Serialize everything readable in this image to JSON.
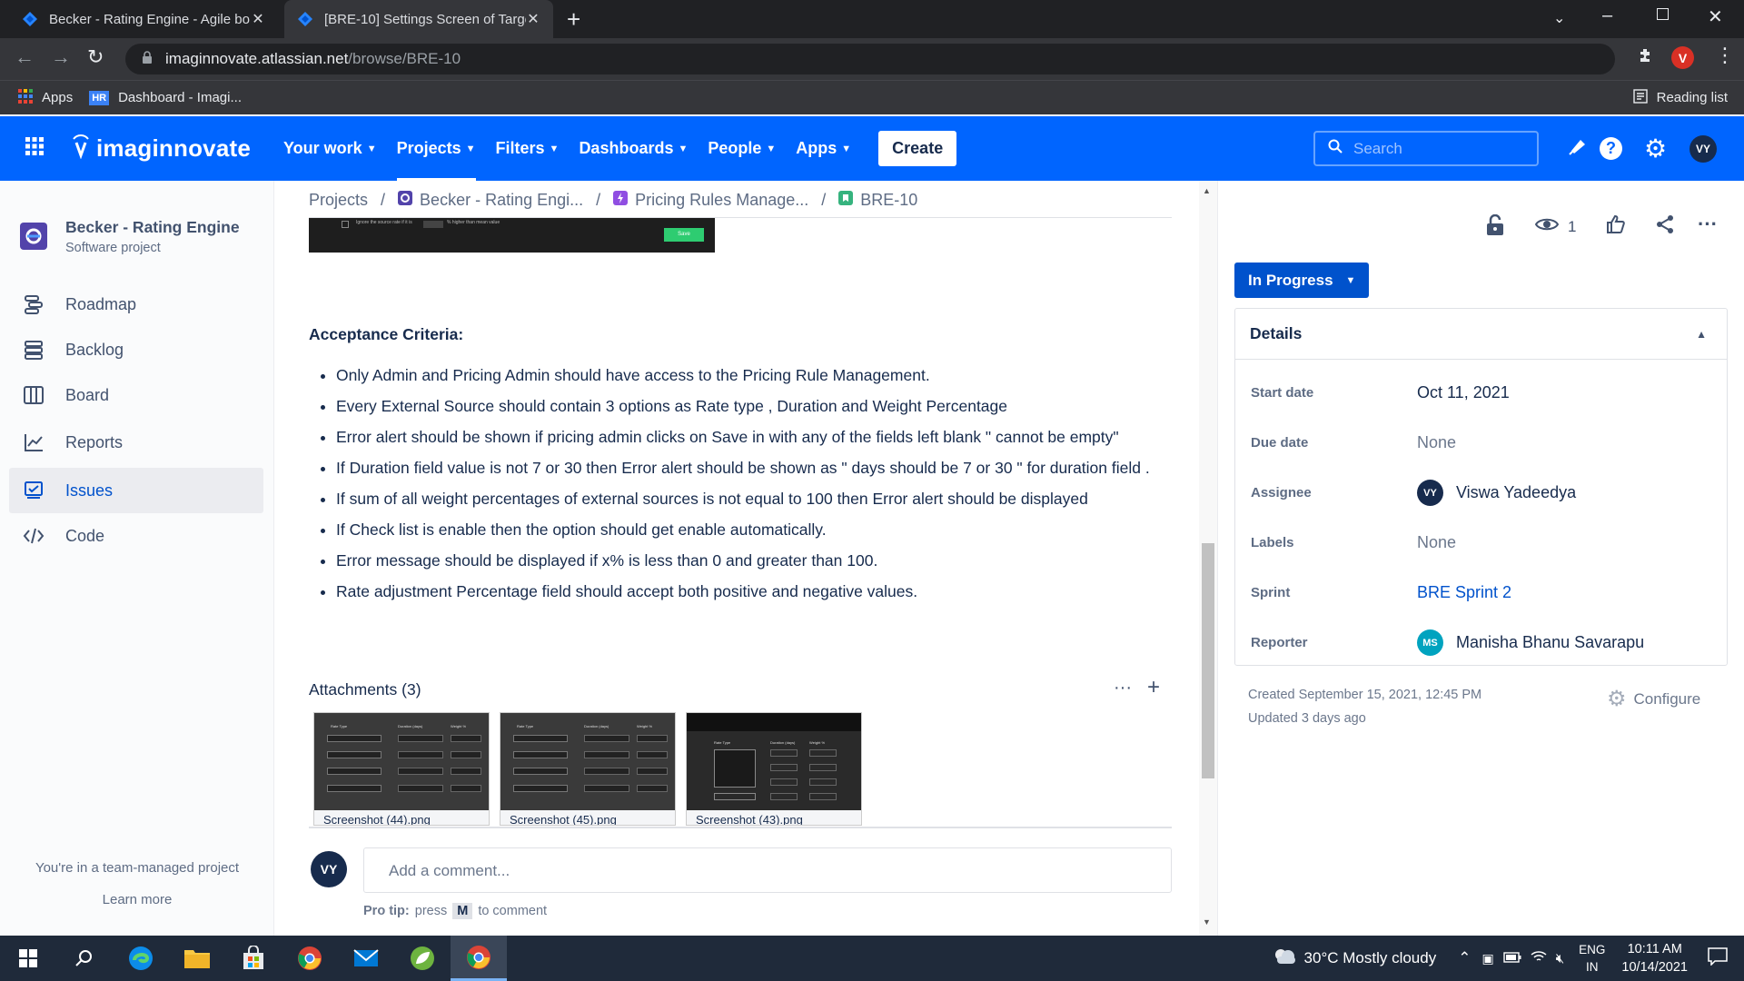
{
  "browser": {
    "tabs": [
      {
        "title": "Becker - Rating Engine - Agile bo"
      },
      {
        "title": "[BRE-10] Settings Screen of Targe"
      }
    ],
    "url_host": "imaginnovate.atlassian.net",
    "url_path": "/browse/BRE-10",
    "profile_initial": "V",
    "bookmarks": [
      {
        "label": "Apps"
      },
      {
        "label": "Dashboard - Imagi..."
      }
    ],
    "bookmark_badge": "HR",
    "reading_list": "Reading list"
  },
  "topnav": {
    "brand": "imaginnovate",
    "items": [
      {
        "label": "Your work"
      },
      {
        "label": "Projects"
      },
      {
        "label": "Filters"
      },
      {
        "label": "Dashboards"
      },
      {
        "label": "People"
      },
      {
        "label": "Apps"
      }
    ],
    "create_label": "Create",
    "search_placeholder": "Search",
    "user_initials": "VY",
    "accent": "#0065ff"
  },
  "sidebar": {
    "project_name": "Becker - Rating Engine",
    "project_type": "Software project",
    "items": [
      {
        "label": "Roadmap",
        "icon": "roadmap-icon"
      },
      {
        "label": "Backlog",
        "icon": "backlog-icon"
      },
      {
        "label": "Board",
        "icon": "board-icon"
      },
      {
        "label": "Reports",
        "icon": "reports-icon"
      },
      {
        "label": "Issues",
        "icon": "issues-icon"
      },
      {
        "label": "Code",
        "icon": "code-icon"
      }
    ],
    "active": "Issues",
    "footer_text": "You're in a team-managed project",
    "learn_more": "Learn more"
  },
  "breadcrumb": {
    "items": [
      "Projects",
      "Becker - Rating Engi...",
      "Pricing Rules Manage...",
      "BRE-10"
    ],
    "sep": "/"
  },
  "issue": {
    "mini_save": "Save",
    "mini_text_1": "Ignore the source rate if it is",
    "mini_text_2": "% higher than mean value",
    "acceptance_title": "Acceptance Criteria:",
    "criteria": [
      "Only Admin and  Pricing Admin  should have access to the Pricing Rule Management.",
      "Every External Source should contain 3 options as Rate type , Duration and Weight Percentage",
      "Error alert should be shown if  pricing admin  clicks on Save  in with any of the fields left blank \" cannot be empty\"",
      " If Duration field  value  is not 7 or 30  then Error alert should be shown  as \" days should be 7 or 30 \"  for  duration field .",
      " If  sum of all weight percentages  of  external sources is  not  equal to 100 then  Error alert  should  be displayed",
      " If Check  list  is enable then  the option should get enable  automatically.",
      "Error message should be displayed  if x%  is less than 0 and greater than 100.",
      "Rate adjustment Percentage  field should accept both positive and negative values."
    ],
    "attachments_title": "Attachments (3)",
    "attachments": [
      {
        "name": "Screenshot (44).png"
      },
      {
        "name": "Screenshot (45).png"
      },
      {
        "name": "Screenshot (43).png"
      }
    ],
    "thumb_headers": [
      "Rate Type",
      "Duration (days)",
      "Weight %"
    ],
    "thumb_select": "Select",
    "comment_placeholder": "Add a comment...",
    "comment_avatar": "VY",
    "pro_tip_label": "Pro tip:",
    "pro_tip_press": "press",
    "pro_tip_key": "M",
    "pro_tip_suffix": "to comment"
  },
  "right_panel": {
    "watchers": "1",
    "status": "In Progress",
    "status_color": "#0052cc",
    "details_title": "Details",
    "fields": [
      {
        "label": "Start date",
        "value": "Oct 11, 2021"
      },
      {
        "label": "Due date",
        "value": "None"
      },
      {
        "label": "Assignee",
        "value": "Viswa Yadeedya",
        "avatar": "VY"
      },
      {
        "label": "Labels",
        "value": "None"
      },
      {
        "label": "Sprint",
        "value": "BRE Sprint 2"
      },
      {
        "label": "Reporter",
        "value": "Manisha Bhanu Savarapu",
        "avatar": "MS"
      }
    ],
    "created": "Created September 15, 2021, 12:45 PM",
    "updated": "Updated 3 days ago",
    "configure": "Configure"
  },
  "taskbar": {
    "weather": "30°C  Mostly cloudy",
    "lang_1": "ENG",
    "lang_2": "IN",
    "time": "10:11 AM",
    "date": "10/14/2021"
  }
}
